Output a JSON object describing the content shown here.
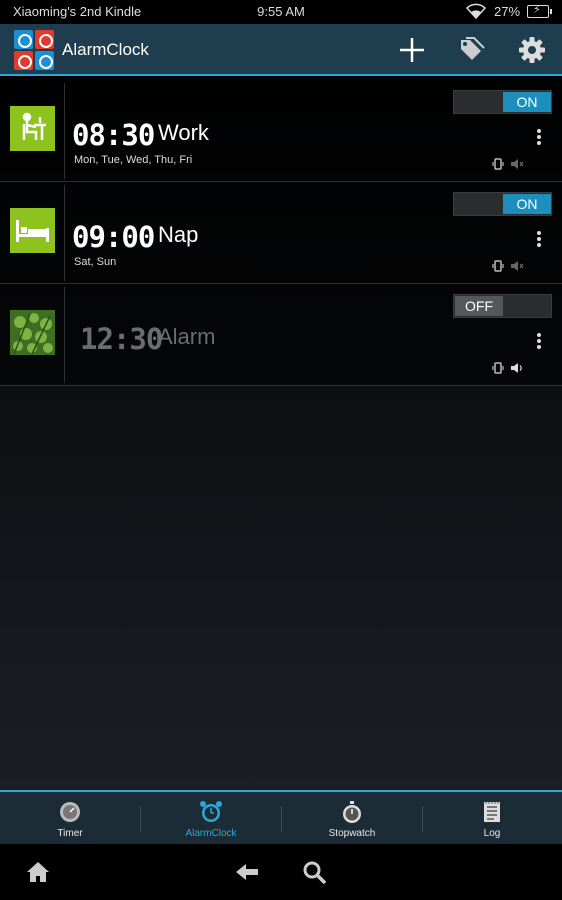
{
  "status_bar": {
    "device_name": "Xiaoming's 2nd Kindle",
    "time": "9:55 AM",
    "battery": "27%"
  },
  "action_bar": {
    "title": "AlarmClock",
    "logo_colors": [
      "#1d8fd4",
      "#e23b2e",
      "#e23b2e",
      "#1d8fd4"
    ],
    "actions": [
      {
        "name": "add-icon"
      },
      {
        "name": "tag-icon"
      },
      {
        "name": "settings-icon"
      }
    ]
  },
  "alarms": [
    {
      "time": "08:30",
      "name": "Work",
      "days": "Mon, Tue, Wed, Thu, Fri",
      "toggle": "ON",
      "enabled": true,
      "icon": "desk-worker-icon",
      "icon_color": "#8ec21f",
      "sound": "mute"
    },
    {
      "time": "09:00",
      "name": "Nap",
      "days": "Sat, Sun",
      "toggle": "ON",
      "enabled": true,
      "icon": "bed-icon",
      "icon_color": "#8ec21f",
      "sound": "mute"
    },
    {
      "time": "12:30",
      "name": "Alarm",
      "days": "",
      "toggle": "OFF",
      "enabled": false,
      "icon": "leaves-photo-icon",
      "icon_color": "#4f8a2a",
      "sound": "on"
    }
  ],
  "tabs": [
    {
      "label": "Timer",
      "icon": "timer-icon",
      "active": false
    },
    {
      "label": "AlarmClock",
      "icon": "alarm-clock-icon",
      "active": true
    },
    {
      "label": "Stopwatch",
      "icon": "stopwatch-icon",
      "active": false
    },
    {
      "label": "Log",
      "icon": "log-icon",
      "active": false
    }
  ],
  "colors": {
    "accent": "#2aa8d8",
    "toggle_on": "#1d8fbf",
    "action_bar": "#1e3d4e"
  }
}
